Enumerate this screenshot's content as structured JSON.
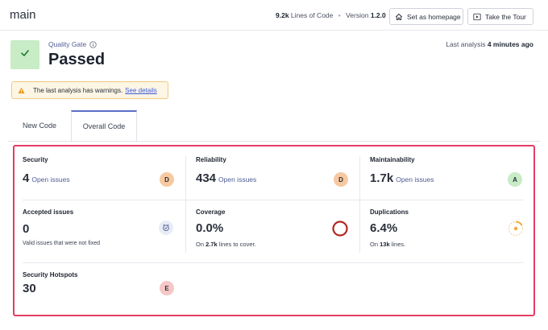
{
  "header": {
    "branch": "main",
    "lines_of_code_value": "9.2k",
    "lines_of_code_label": "Lines of Code",
    "separator": "•",
    "version_label": "Version",
    "version_value": "1.2.0",
    "set_homepage_label": "Set as homepage",
    "tour_label": "Take the Tour"
  },
  "quality_gate": {
    "label": "Quality Gate",
    "status": "Passed",
    "last_analysis_label": "Last analysis",
    "last_analysis_value": "4 minutes ago"
  },
  "warning": {
    "text": "The last analysis has warnings.",
    "link": "See details"
  },
  "tabs": [
    {
      "label": "New Code",
      "active": false
    },
    {
      "label": "Overall Code",
      "active": true
    }
  ],
  "metrics": {
    "security": {
      "title": "Security",
      "value": "4",
      "unit": "Open issues",
      "rating": "D"
    },
    "reliability": {
      "title": "Reliability",
      "value": "434",
      "unit": "Open issues",
      "rating": "D"
    },
    "maintainability": {
      "title": "Maintainability",
      "value": "1.7k",
      "unit": "Open issues",
      "rating": "A"
    },
    "accepted": {
      "title": "Accepted issues",
      "value": "0",
      "sub": "Valid issues that were not fixed"
    },
    "coverage": {
      "title": "Coverage",
      "value": "0.0%",
      "sub_prefix": "On",
      "sub_value": "2.7k",
      "sub_suffix": "lines to cover.",
      "percent": 0
    },
    "duplications": {
      "title": "Duplications",
      "value": "6.4%",
      "sub_prefix": "On",
      "sub_value": "13k",
      "sub_suffix": "lines.",
      "percent": 6.4
    },
    "hotspots": {
      "title": "Security Hotspots",
      "value": "30",
      "rating": "E"
    }
  },
  "colors": {
    "rating_A": "#c8ecc6",
    "rating_D": "#f7c9a0",
    "rating_E": "#f6c7c7",
    "panel_border": "#e53d63",
    "passed_bg": "#c8ecc6",
    "coverage_ring": "#b3261e",
    "duplication_ring": "#f2a93b"
  },
  "icons": {
    "home": "home-icon",
    "play": "play-icon",
    "check": "check-icon",
    "info": "info-icon",
    "warning": "warning-icon",
    "accepted": "shield-check-icon"
  }
}
